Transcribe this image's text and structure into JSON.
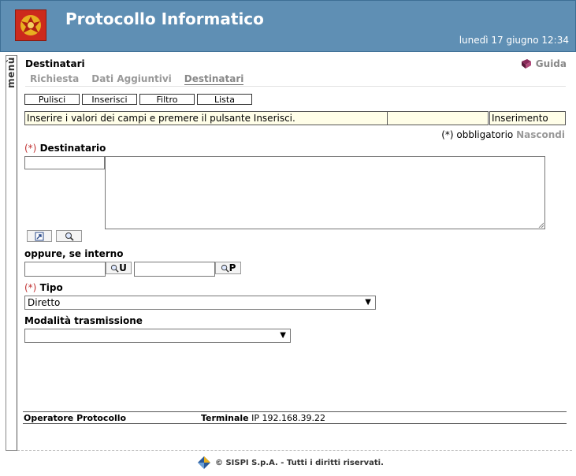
{
  "header": {
    "app_title": "Protocollo Informatico",
    "datetime": "lunedì 17 giugno 12:34"
  },
  "sidebar": {
    "menu_label": "menù"
  },
  "page": {
    "title": "Destinatari",
    "help_label": "Guida"
  },
  "tabs": [
    {
      "label": "Richiesta",
      "active": false
    },
    {
      "label": "Dati Aggiuntivi",
      "active": false
    },
    {
      "label": "Destinatari",
      "active": true
    }
  ],
  "toolbar": {
    "clear_label": "Pulisci",
    "insert_label": "Inserisci",
    "filter_label": "Filtro",
    "list_label": "Lista"
  },
  "status": {
    "message": "Inserire i valori dei campi e premere il pulsante Inserisci.",
    "secondary": "",
    "mode": "Inserimento"
  },
  "required_note": {
    "text": "(*) obbligatorio",
    "hide_label": "Nascondi"
  },
  "form": {
    "required_marker": "(*)",
    "recipient_label": "Destinatario",
    "recipient_code": "",
    "recipient_text": "",
    "internal_label": "oppure, se interno",
    "internal_user_value": "",
    "internal_user_btn": "U",
    "internal_pos_value": "",
    "internal_pos_btn": "P",
    "type_label": "Tipo",
    "type_value": "Diretto",
    "transmission_label": "Modalità trasmissione",
    "transmission_value": ""
  },
  "footer": {
    "operator": "Operatore Protocollo",
    "terminal_label": "Terminale",
    "terminal_ip": "IP 192.168.39.22",
    "copyright": "© SISPI S.p.A. - Tutti i diritti riservati."
  },
  "colors": {
    "header_bg": "#5f8fb4",
    "required": "#c03030",
    "message_bg": "#fffee8"
  }
}
